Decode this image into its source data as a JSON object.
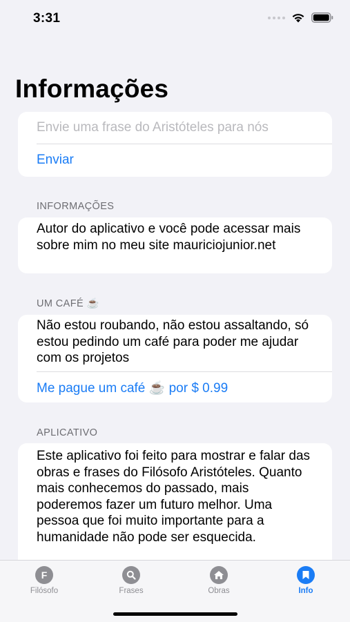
{
  "status_bar": {
    "time": "3:31"
  },
  "page": {
    "title": "Informações"
  },
  "phrase_form": {
    "placeholder": "Envie uma frase do Aristóteles para nós",
    "value": "",
    "send_label": "Enviar"
  },
  "info_section": {
    "header": "INFORMAÇÕES",
    "text": "Autor do aplicativo e você pode acessar mais sobre mim no meu site mauriciojunior.net"
  },
  "coffee_section": {
    "header": "UM CAFÉ ☕️",
    "text": "Não estou roubando, não estou assaltando, só estou pedindo um café para poder me ajudar com os projetos",
    "buy_label": "Me pague um café ☕️ por $ 0.99"
  },
  "app_section": {
    "header": "APLICATIVO",
    "text": "Este aplicativo foi feito para mostrar e falar das obras e frases do Filósofo Aristóteles. Quanto mais conhecemos do passado, mais poderemos fazer um futuro melhor. Uma pessoa que foi muito importante para a humanidade não pode ser esquecida."
  },
  "tab_bar": {
    "tabs": [
      {
        "label": "Filósofo",
        "icon": "letter-f-icon",
        "glyph": "F",
        "active": false
      },
      {
        "label": "Frases",
        "icon": "magnifying-glass-icon",
        "active": false
      },
      {
        "label": "Obras",
        "icon": "house-icon",
        "active": false
      },
      {
        "label": "Info",
        "icon": "bookmark-icon",
        "active": true
      }
    ]
  },
  "colors": {
    "accent": "#1a7cf5",
    "background": "#f2f2f7",
    "inactive": "#8e8e93"
  }
}
